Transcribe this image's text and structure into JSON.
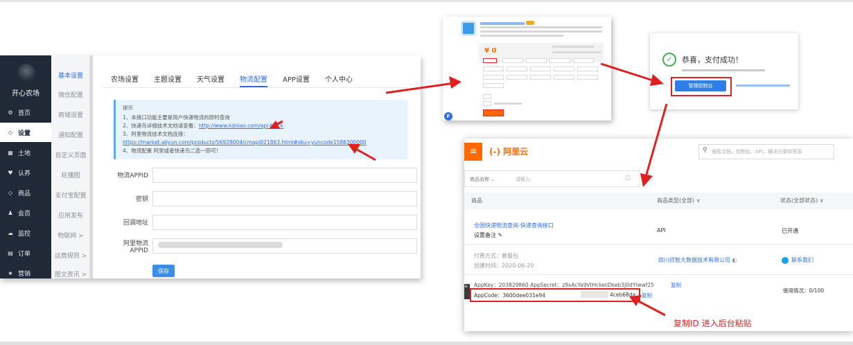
{
  "admin": {
    "brand": "开心农场",
    "nav": [
      {
        "icon": "⚙",
        "label": "首页"
      },
      {
        "icon": "◇",
        "label": "设置"
      },
      {
        "icon": "▦",
        "label": "土地"
      },
      {
        "icon": "♥",
        "label": "认养"
      },
      {
        "icon": "◇",
        "label": "商品"
      },
      {
        "icon": "♟",
        "label": "会员"
      },
      {
        "icon": "☁",
        "label": "监控"
      },
      {
        "icon": "▤",
        "label": "订单"
      },
      {
        "icon": "★",
        "label": "营销"
      }
    ],
    "sub_nav": [
      "基本设置",
      "微信配置",
      "商城设置",
      "通知配置",
      "自定义页面",
      "轮播图",
      "支付宝配置",
      "应用发布",
      "物联网 >",
      "运费规则 >",
      "图文资讯 >"
    ],
    "tabs": [
      "农场设置",
      "主题设置",
      "天气设置",
      "物流配置",
      "APP设置",
      "个人中心"
    ],
    "notice": {
      "title": "提示",
      "line1": "1、本接口功能主要是用户快递物流的即时查询",
      "line2_prefix": "2、快递鸟详细技术文档请查看：",
      "line2_link": "http://www.kdniao.com/api-track",
      "line3_prefix": "3、阿里物流技术文档连接：",
      "line3_link": "https://market.aliyun.com/products/56928004/cmapi021863.html#sku=yuncode1586300000",
      "line4": "4、物流配置 阿里或者快递鸟二选一即可！"
    },
    "form": {
      "appid_label": "物流APPID",
      "secret_label": "密钥",
      "callback_label": "回调地址",
      "ali_label_1": "阿里物流",
      "ali_label_2": "APPID",
      "save": "保存"
    }
  },
  "product": {
    "price": "¥ 0"
  },
  "payment": {
    "title": "恭喜，支付成功！",
    "console_button": "管理控制台"
  },
  "console": {
    "logo": "(-) 阿里云",
    "search_placeholder": "搜索文档、控制台、API、解决方案和资源",
    "filter_label": "商品名称",
    "filter_placeholder": "请输入",
    "headers": {
      "product": "商品",
      "type": "商品类型(全部)",
      "status": "状态(全部状态)"
    },
    "row": {
      "name": "全国快递物流查询-快递查询接口",
      "remark": "设置备注",
      "type": "API",
      "status": "已开通",
      "pay_mode": "付费方式：套餐包",
      "created": "创建时间：2020-06-20",
      "company": "四川欣智大数据技术有限公司",
      "contact": "联系我们",
      "appkey_line": "AppKey：203829860    AppSecret：z9xAcYa9VtHckeliDkeb3J0dYlwwf25",
      "copy": "复制",
      "appcode_prefix": "AppCode：3600dee031e94",
      "appcode_suffix": "4ceb68da",
      "usage": "使用情况：0/100"
    },
    "annotation": "复制ID 进入后台粘贴"
  },
  "colors": {
    "accent": "#2f6fe0",
    "aliyun": "#ff6a00",
    "highlight": "#e02020",
    "success": "#3fb24f",
    "sidebar": "#1f2937"
  }
}
